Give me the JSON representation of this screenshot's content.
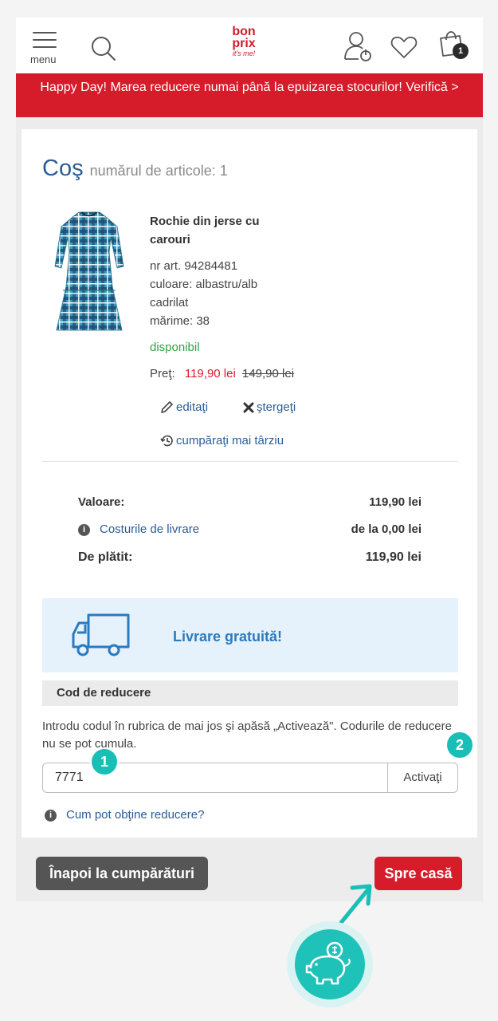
{
  "header": {
    "menu_label": "menu",
    "logo_line1": "bon",
    "logo_line2": "prix",
    "logo_tagline": "it's me!",
    "cart_badge": "1"
  },
  "promo": {
    "text": "Happy Day! Marea reducere numai până la epuizarea stocurilor! Verifică >"
  },
  "cart": {
    "title": "Coş",
    "count_label": "numărul de articole: 1"
  },
  "product": {
    "name": "Rochie din jerse cu carouri",
    "article": "nr art. 94284481",
    "color": "culoare: albastru/alb cadrilat",
    "size": "mărime: 38",
    "availability": "disponibil",
    "price_label": "Preţ:",
    "price_new": "119,90 lei",
    "price_old": "149,90 lei",
    "edit_label": "editaţi",
    "delete_label": "ştergeţi",
    "later_label": "cumpăraţi mai târziu"
  },
  "totals": {
    "value_label": "Valoare:",
    "value_amount": "119,90 lei",
    "shipping_label": "Costurile de livrare",
    "shipping_amount": "de la 0,00 lei",
    "pay_label": "De plătit:",
    "pay_amount": "119,90 lei"
  },
  "shipping": {
    "text": "Livrare gratuită!"
  },
  "coupon": {
    "heading": "Cod de reducere",
    "description": "Introdu codul în rubrica de mai jos şi apăsă „Activează\". Codurile de reducere nu se pot cumula.",
    "value": "7771",
    "button": "Activaţi",
    "help_link": "Cum pot obţine reducere?"
  },
  "steps": {
    "one": "1",
    "two": "2"
  },
  "buttons": {
    "back": "Înapoi la cumpărături",
    "checkout": "Spre casă"
  },
  "colors": {
    "brand_red": "#d61c2a",
    "link_blue": "#2a5d96",
    "teal": "#19bfb6"
  }
}
